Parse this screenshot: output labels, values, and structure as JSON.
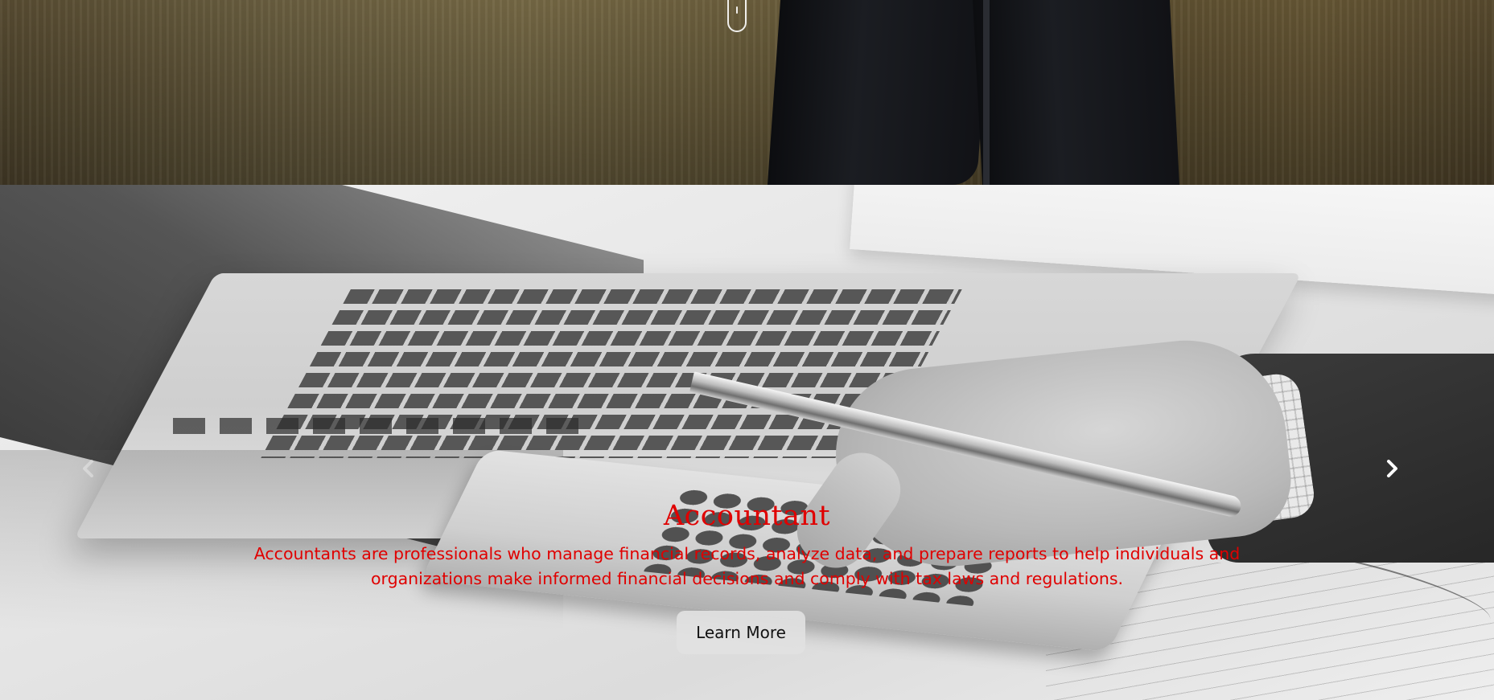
{
  "hero": {
    "scroll_icon": "mouse-scroll-icon"
  },
  "slide": {
    "title": "Accountant",
    "description": "Accountants are professionals who manage financial records, analyze data, and prepare reports to help individuals and organizations make informed financial decisions and comply with tax laws and regulations.",
    "button_label": "Learn More",
    "title_color": "#e00000",
    "text_color": "#e00000"
  },
  "carousel": {
    "next_icon": "chevron-right-icon",
    "prev_icon": "chevron-left-icon"
  }
}
